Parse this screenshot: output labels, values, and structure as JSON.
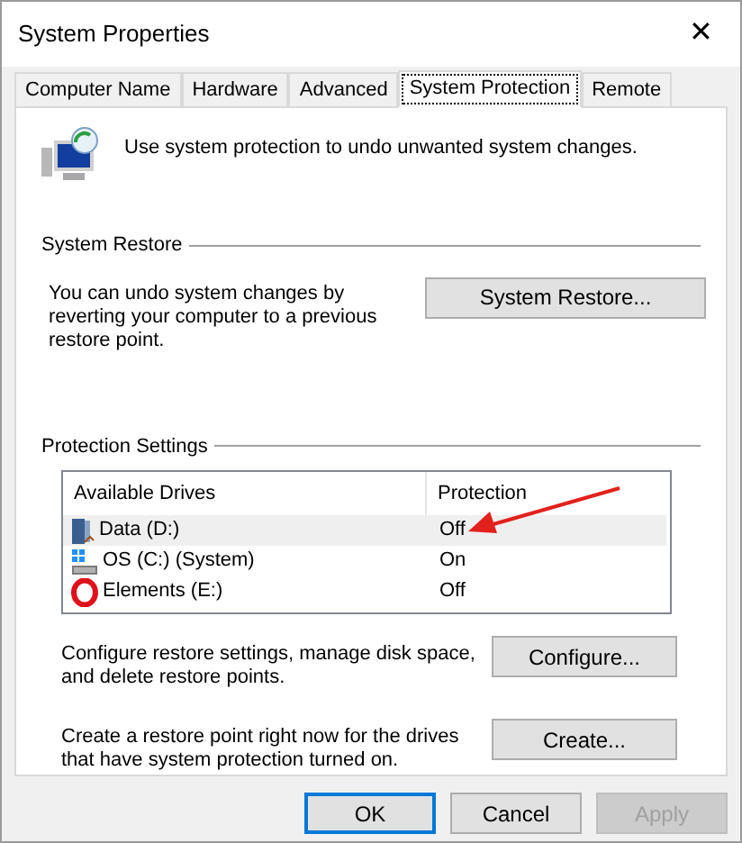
{
  "window": {
    "title": "System Properties",
    "close": "✕"
  },
  "tabs": [
    {
      "label": "Computer Name",
      "selected": false
    },
    {
      "label": "Hardware",
      "selected": false
    },
    {
      "label": "Advanced",
      "selected": false
    },
    {
      "label": "System Protection",
      "selected": true
    },
    {
      "label": "Remote",
      "selected": false
    }
  ],
  "intro": "Use system protection to undo unwanted system changes.",
  "system_restore": {
    "heading": "System Restore",
    "text": "You can undo system changes by reverting your computer to a previous restore point.",
    "button": {
      "label": "System Restore...",
      "disabled": false
    }
  },
  "protection_settings": {
    "heading": "Protection Settings",
    "columns": [
      "Available Drives",
      "Protection"
    ],
    "drives": [
      {
        "name": "Data (D:)",
        "kind": "data",
        "protection": "Off",
        "selected": true
      },
      {
        "name": "OS (C:) (System)",
        "kind": "system",
        "protection": "On",
        "selected": false
      },
      {
        "name": "Elements (E:)",
        "kind": "external",
        "protection": "Off",
        "selected": false
      }
    ],
    "actions": [
      {
        "text": "Configure restore settings, manage disk space, and delete restore points.",
        "button": {
          "label": "Configure...",
          "disabled": false
        }
      },
      {
        "text": "Create a restore point right now for the drives that have system protection turned on.",
        "button": {
          "label": "Create...",
          "disabled": false
        }
      }
    ]
  },
  "buttons": [
    {
      "label": "OK",
      "default": true,
      "disabled": false
    },
    {
      "label": "Cancel",
      "default": false,
      "disabled": false
    },
    {
      "label": "Apply",
      "default": false,
      "disabled": true
    }
  ]
}
